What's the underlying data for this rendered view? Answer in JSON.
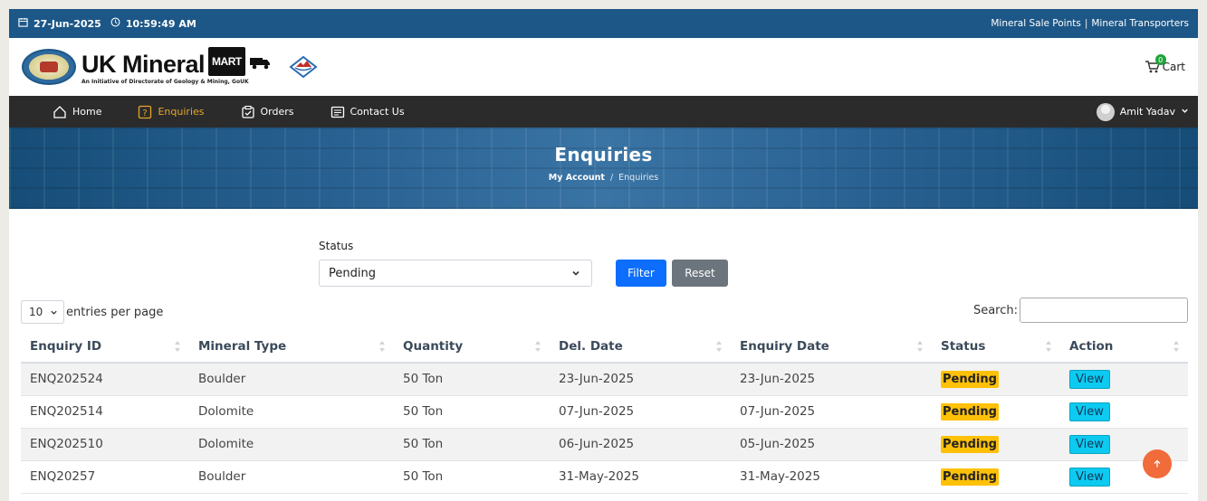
{
  "topbar": {
    "date": "27-Jun-2025",
    "time": "10:59:49 AM",
    "links": [
      "Mineral Sale Points",
      "Mineral Transporters"
    ],
    "separator": "|"
  },
  "header": {
    "brand_title": "UK Mineral",
    "brand_mart": "MART",
    "brand_subtitle": "An Initiative of Directorate of Geology & Mining, GoUK",
    "cart_label": "Cart",
    "cart_count": "0"
  },
  "nav": {
    "items": [
      {
        "label": "Home",
        "icon": "home-icon",
        "active": false
      },
      {
        "label": "Enquiries",
        "icon": "question-icon",
        "active": true
      },
      {
        "label": "Orders",
        "icon": "clipboard-check-icon",
        "active": false
      },
      {
        "label": "Contact Us",
        "icon": "message-icon",
        "active": false
      }
    ],
    "user_name": "Amit Yadav"
  },
  "banner": {
    "title": "Enquiries",
    "breadcrumb_parent": "My Account",
    "breadcrumb_sep": "/",
    "breadcrumb_current": "Enquiries"
  },
  "filter": {
    "label": "Status",
    "selected": "Pending",
    "filter_label": "Filter",
    "reset_label": "Reset"
  },
  "table_controls": {
    "entries_value": "10",
    "entries_label": "entries per page",
    "search_label": "Search:"
  },
  "table": {
    "columns": [
      "Enquiry ID",
      "Mineral Type",
      "Quantity",
      "Del. Date",
      "Enquiry Date",
      "Status",
      "Action"
    ],
    "rows": [
      {
        "id": "ENQ202524",
        "mineral": "Boulder",
        "quantity": "50 Ton",
        "del_date": "23-Jun-2025",
        "enq_date": "23-Jun-2025",
        "status": "Pending",
        "action": "View"
      },
      {
        "id": "ENQ202514",
        "mineral": "Dolomite",
        "quantity": "50 Ton",
        "del_date": "07-Jun-2025",
        "enq_date": "07-Jun-2025",
        "status": "Pending",
        "action": "View"
      },
      {
        "id": "ENQ202510",
        "mineral": "Dolomite",
        "quantity": "50 Ton",
        "del_date": "06-Jun-2025",
        "enq_date": "05-Jun-2025",
        "status": "Pending",
        "action": "View"
      },
      {
        "id": "ENQ20257",
        "mineral": "Boulder",
        "quantity": "50 Ton",
        "del_date": "31-May-2025",
        "enq_date": "31-May-2025",
        "status": "Pending",
        "action": "View"
      }
    ]
  },
  "colors": {
    "topbar": "#1d5787",
    "nav": "#2b2b2b",
    "nav_active": "#e8a52a",
    "filter_button": "#0d6efd",
    "reset_button": "#6c757d",
    "pending_badge": "#ffc107",
    "view_button": "#0dcaf0",
    "scroll_top": "#f26b3a"
  }
}
